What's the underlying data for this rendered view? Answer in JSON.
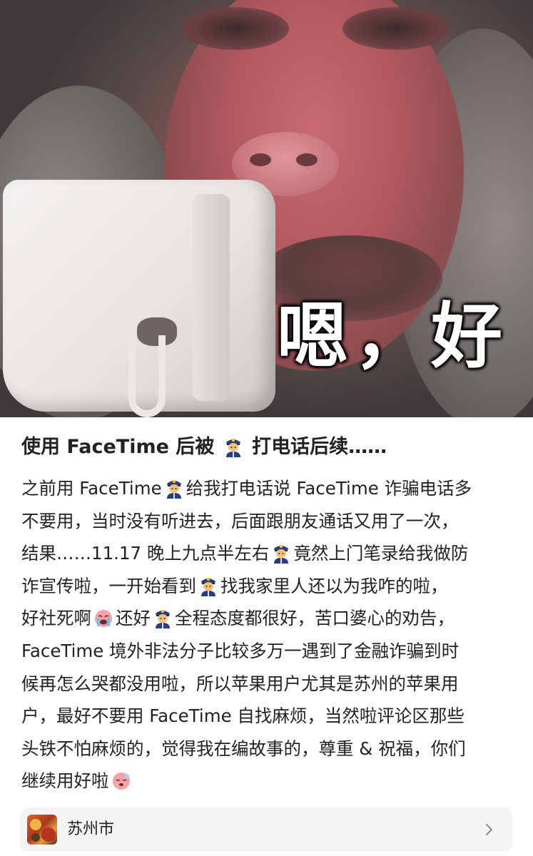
{
  "hero": {
    "caption": "嗯，好"
  },
  "post": {
    "title_parts": [
      "使用 FaceTime 后被",
      "打电话后续……"
    ],
    "body_lines": [
      [
        "之前用 FaceTime",
        "给我打电话说 FaceTime 诈骗电话多"
      ],
      [
        "不要用，当时没有听进去，后面跟朋友通话又用了一次，"
      ],
      [
        "结果……11.17 晚上九点半左右",
        "竟然上门笔录给我做防"
      ],
      [
        "诈宣传啦，一开始看到",
        "找我家里人还以为我咋的啦，"
      ],
      [
        "好社死啊",
        "还好",
        "全程态度都很好，苦口婆心的劝告，"
      ],
      [
        "FaceTime 境外非法分子比较多万一遇到了金融诈骗到时"
      ],
      [
        "候再怎么哭都没用啦，所以苹果用户尤其是苏州的苹果用"
      ],
      [
        "户，最好不要用 FaceTime 自找麻烦，当然啦评论区那些"
      ],
      [
        "头铁不怕麻烦的，觉得我在编故事的，尊重 & 祝福，你们"
      ],
      [
        "继续用好啦"
      ]
    ],
    "emoji": {
      "police": "police-officer-emoji",
      "crying": "loudly-crying-face-emoji",
      "sleepy": "sleepy-face-emoji"
    }
  },
  "location": {
    "label": "苏州市",
    "icon": "chevron-right-icon"
  }
}
